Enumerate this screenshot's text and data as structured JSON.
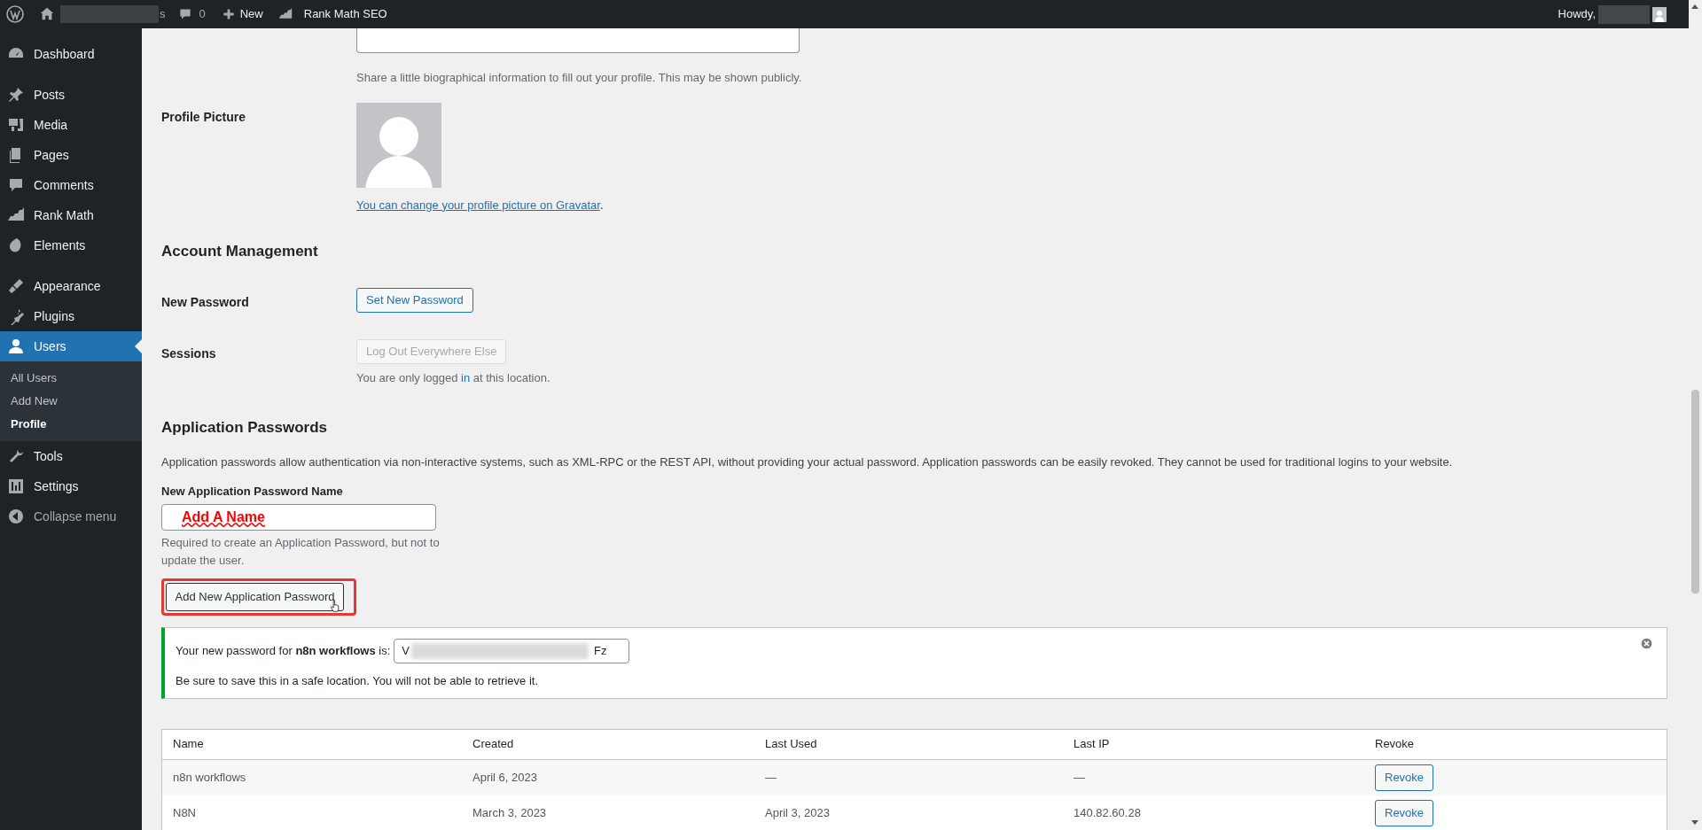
{
  "admin_bar": {
    "comments_count": "0",
    "new_label": "New",
    "plugin_label": "Rank Math SEO",
    "site_name_tail": "s",
    "greeting": "Howdy,"
  },
  "sidebar": {
    "groups": [
      {
        "items": [
          {
            "label": "Dashboard",
            "selected": false
          }
        ]
      },
      {
        "items": [
          {
            "label": "Posts",
            "selected": false
          },
          {
            "label": "Media",
            "selected": false
          },
          {
            "label": "Pages",
            "selected": false
          },
          {
            "label": "Comments",
            "selected": false
          },
          {
            "label": "Rank Math",
            "selected": false
          },
          {
            "label": "Elements",
            "selected": false
          }
        ]
      },
      {
        "items": [
          {
            "label": "Appearance",
            "selected": false
          },
          {
            "label": "Plugins",
            "selected": false
          },
          {
            "label": "Users",
            "selected": true,
            "children": [
              {
                "label": "All Users",
                "selected": false
              },
              {
                "label": "Add New",
                "selected": false
              },
              {
                "label": "Profile",
                "selected": true
              }
            ]
          },
          {
            "label": "Tools",
            "selected": false
          },
          {
            "label": "Settings",
            "selected": false
          }
        ]
      }
    ],
    "collapse_label": "Collapse menu"
  },
  "bio_description": "Share a little biographical information to fill out your profile. This may be shown publicly.",
  "profile_picture": {
    "label": "Profile Picture",
    "link": "You can change your profile picture on Gravatar",
    "link_tail": "."
  },
  "account_management": {
    "heading": "Account Management",
    "rows": [
      {
        "label": "New Password",
        "button": "Set New Password",
        "disabled": false
      },
      {
        "label": "Sessions",
        "button": "Log Out Everywhere Else",
        "disabled": true,
        "note_before": "You are only logged ",
        "note_link": "in",
        "note_after": " at this location."
      }
    ]
  },
  "application_passwords": {
    "heading": "Application Passwords",
    "description": "Application passwords allow authentication via non-interactive systems, such as XML-RPC or the REST API, without providing your actual password. Application passwords can be easily revoked. They cannot be used for traditional logins to your website.",
    "name_label": "New Application Password Name",
    "annotation": "Add A Name",
    "help": "Required to create an Application Password, but not to update the user.",
    "add_button": "Add New Application Password",
    "notice": {
      "message": "Your new password for **n8n workflows** is:",
      "password_start": "V",
      "password_end": "Fz",
      "warning": "Be sure to save this in a safe location. You will not be able to retrieve it."
    },
    "table": {
      "columns": [
        "Name",
        "Created",
        "Last Used",
        "Last IP",
        "Revoke"
      ],
      "rows": [
        {
          "name": "n8n workflows",
          "created": "April 6, 2023",
          "last_used": "—",
          "last_ip": "—",
          "revoke": "Revoke"
        },
        {
          "name": "N8N",
          "created": "March 3, 2023",
          "last_used": "April 3, 2023",
          "last_ip": "140.82.60.28",
          "revoke": "Revoke"
        }
      ]
    }
  }
}
